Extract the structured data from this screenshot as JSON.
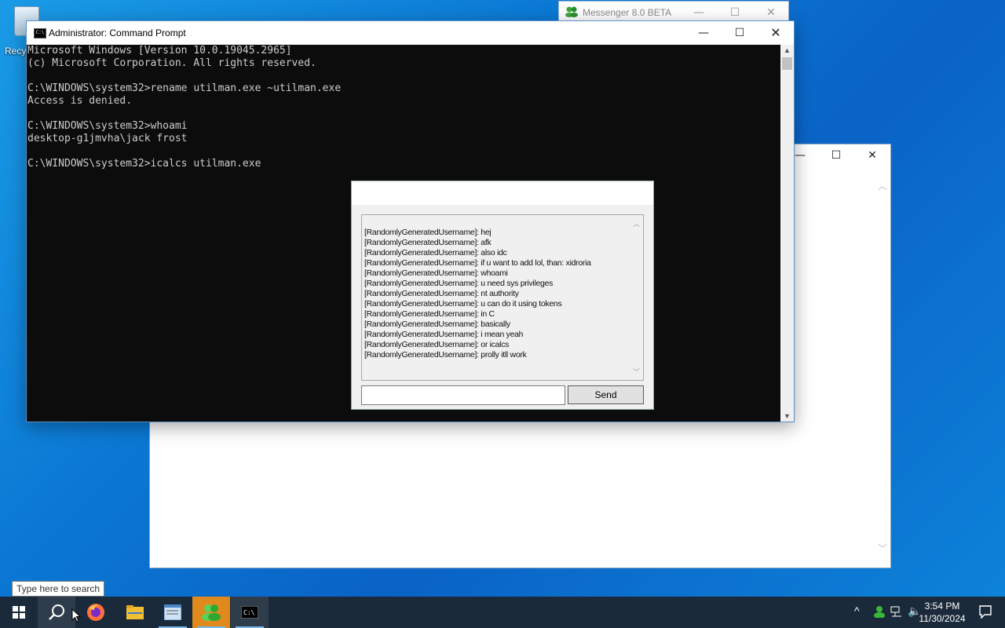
{
  "desktop": {
    "recycle_bin_label": "Recy"
  },
  "messenger_window": {
    "title": "Messenger 8.0 BETA"
  },
  "cmd": {
    "title": "Administrator: Command Prompt",
    "lines": [
      "Microsoft Windows [Version 10.0.19045.2965]",
      "(c) Microsoft Corporation. All rights reserved.",
      "",
      "C:\\WINDOWS\\system32>rename utilman.exe ~utilman.exe",
      "Access is denied.",
      "",
      "C:\\WINDOWS\\system32>whoami",
      "desktop-g1jmvha\\jack frost",
      "",
      "C:\\WINDOWS\\system32>icalcs utilman.exe"
    ]
  },
  "chat": {
    "messages": [
      "[RandomlyGeneratedUsername]: hej",
      "[RandomlyGeneratedUsername]: afk",
      "[RandomlyGeneratedUsername]: also idc",
      "[RandomlyGeneratedUsername]: if u want to add lol, than: xidroria",
      "[RandomlyGeneratedUsername]: whoami",
      "[RandomlyGeneratedUsername]: u need sys privileges",
      "[RandomlyGeneratedUsername]: nt authority",
      "[RandomlyGeneratedUsername]: u can do it using tokens",
      "[RandomlyGeneratedUsername]: in C",
      "[RandomlyGeneratedUsername]: basically",
      "[RandomlyGeneratedUsername]: i mean yeah",
      "[RandomlyGeneratedUsername]: or icalcs",
      "[RandomlyGeneratedUsername]: prolly itll work"
    ],
    "input_value": "",
    "send_label": "Send"
  },
  "search_tooltip": "Type here to search",
  "taskbar": {
    "apps": [
      "start-icon",
      "search-icon",
      "firefox-icon",
      "file-explorer-icon",
      "notepad-icon",
      "messenger-icon",
      "cmd-icon"
    ],
    "time": "3:54 PM",
    "date": "11/30/2024"
  },
  "colors": {
    "console_bg": "#0c0c0c",
    "console_fg": "#cccccc",
    "taskbar_bg": "#1b2a3a"
  }
}
